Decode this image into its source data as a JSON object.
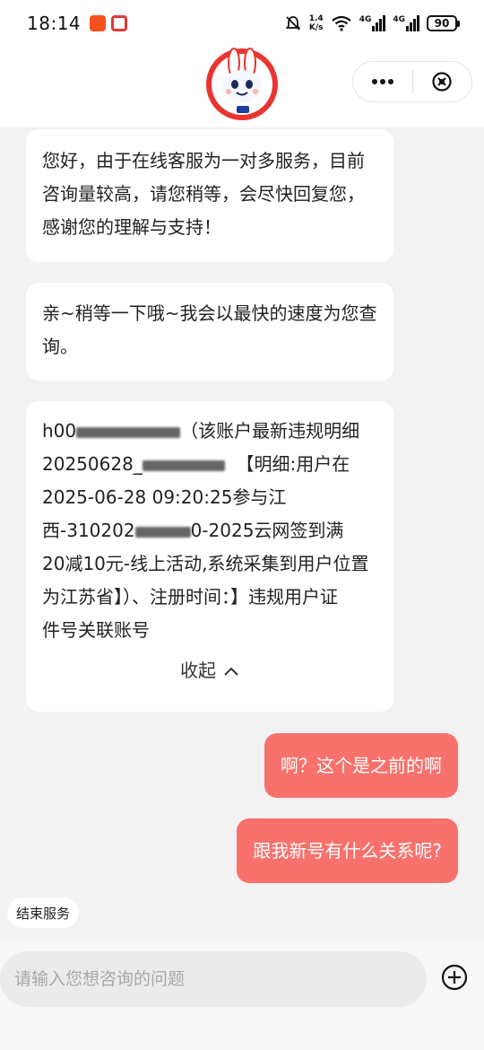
{
  "status_bar": {
    "time": "18:14",
    "net_speed_value": "1.4",
    "net_speed_unit": "K/s",
    "signal_1": "4G",
    "signal_2": "4G",
    "battery": "90"
  },
  "messages": {
    "m1": {
      "line1": "您好，由于在线客服为一对多服务，目前",
      "line2": "咨询量较高，请您稍等，会尽快回复您，",
      "line3": "感谢您的理解与支持！"
    },
    "m2": {
      "line1": "亲~稍等一下哦~我会以最快的速度为您查",
      "line2": "询。"
    },
    "m3": {
      "line1_a": "h00",
      "line1_b": "（该账户最新违规明细",
      "line2_a": "20250628_",
      "line2_b": "【明细:用户在",
      "line3": "2025-06-28 09:20:25参与江",
      "line4_a": "西-310202",
      "line4_b": "0-2025云网签到满",
      "line5": "20减10元-线上活动,系统采集到用户位置",
      "line6": "为江苏省】）、注册时间：】违规用户证",
      "line7": "件号关联账号",
      "collapse_label": "收起"
    },
    "user1": "啊？这个是之前的啊",
    "user2": "跟我新号有什么关系呢?"
  },
  "end_service_label": "结束服务",
  "input": {
    "placeholder": "请输入您想咨询的问题",
    "value": ""
  },
  "colors": {
    "accent": "#f8716c",
    "background": "#f2f2f2",
    "bubble_bg": "#ffffff"
  },
  "icons": [
    "more-icon",
    "close-circle-icon",
    "chevron-up-icon",
    "add-circle-icon",
    "bell-muted-icon",
    "wifi-icon"
  ]
}
